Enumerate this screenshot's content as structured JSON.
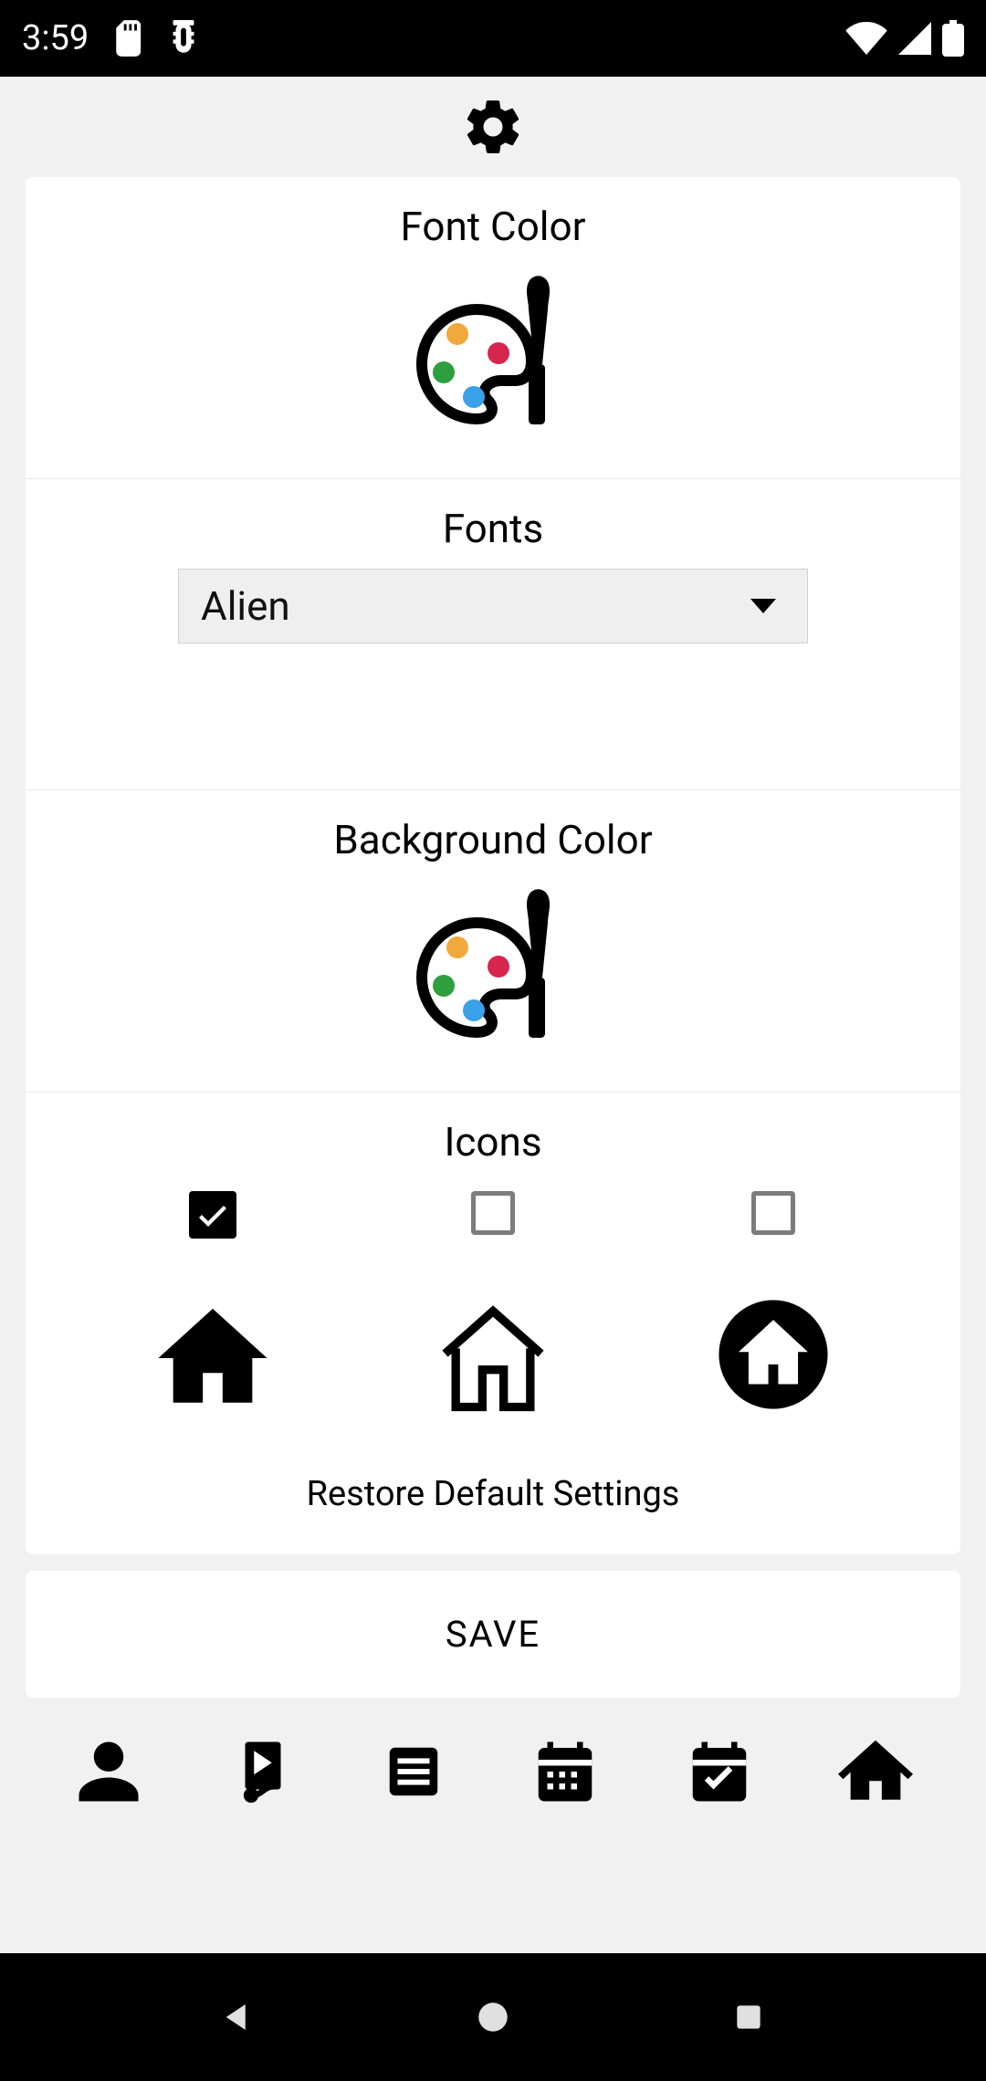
{
  "statusbar": {
    "time": "3:59"
  },
  "sections": {
    "fontColor": {
      "title": "Font Color"
    },
    "fonts": {
      "title": "Fonts",
      "selected": "Alien"
    },
    "bgColor": {
      "title": "Background Color"
    },
    "icons": {
      "title": "Icons",
      "options": [
        {
          "checked": true
        },
        {
          "checked": false
        },
        {
          "checked": false
        }
      ]
    }
  },
  "restore_label": "Restore Default Settings",
  "save_label": "SAVE"
}
